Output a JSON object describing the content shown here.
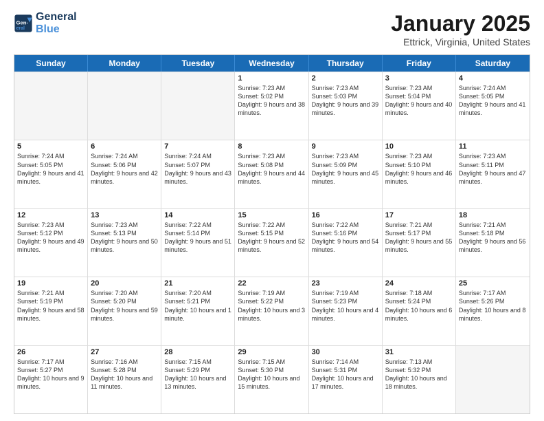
{
  "header": {
    "logo_line1": "General",
    "logo_line2": "Blue",
    "month": "January 2025",
    "location": "Ettrick, Virginia, United States"
  },
  "days_of_week": [
    "Sunday",
    "Monday",
    "Tuesday",
    "Wednesday",
    "Thursday",
    "Friday",
    "Saturday"
  ],
  "weeks": [
    [
      {
        "day": "",
        "text": ""
      },
      {
        "day": "",
        "text": ""
      },
      {
        "day": "",
        "text": ""
      },
      {
        "day": "1",
        "text": "Sunrise: 7:23 AM\nSunset: 5:02 PM\nDaylight: 9 hours and 38 minutes."
      },
      {
        "day": "2",
        "text": "Sunrise: 7:23 AM\nSunset: 5:03 PM\nDaylight: 9 hours and 39 minutes."
      },
      {
        "day": "3",
        "text": "Sunrise: 7:23 AM\nSunset: 5:04 PM\nDaylight: 9 hours and 40 minutes."
      },
      {
        "day": "4",
        "text": "Sunrise: 7:24 AM\nSunset: 5:05 PM\nDaylight: 9 hours and 41 minutes."
      }
    ],
    [
      {
        "day": "5",
        "text": "Sunrise: 7:24 AM\nSunset: 5:05 PM\nDaylight: 9 hours and 41 minutes."
      },
      {
        "day": "6",
        "text": "Sunrise: 7:24 AM\nSunset: 5:06 PM\nDaylight: 9 hours and 42 minutes."
      },
      {
        "day": "7",
        "text": "Sunrise: 7:24 AM\nSunset: 5:07 PM\nDaylight: 9 hours and 43 minutes."
      },
      {
        "day": "8",
        "text": "Sunrise: 7:23 AM\nSunset: 5:08 PM\nDaylight: 9 hours and 44 minutes."
      },
      {
        "day": "9",
        "text": "Sunrise: 7:23 AM\nSunset: 5:09 PM\nDaylight: 9 hours and 45 minutes."
      },
      {
        "day": "10",
        "text": "Sunrise: 7:23 AM\nSunset: 5:10 PM\nDaylight: 9 hours and 46 minutes."
      },
      {
        "day": "11",
        "text": "Sunrise: 7:23 AM\nSunset: 5:11 PM\nDaylight: 9 hours and 47 minutes."
      }
    ],
    [
      {
        "day": "12",
        "text": "Sunrise: 7:23 AM\nSunset: 5:12 PM\nDaylight: 9 hours and 49 minutes."
      },
      {
        "day": "13",
        "text": "Sunrise: 7:23 AM\nSunset: 5:13 PM\nDaylight: 9 hours and 50 minutes."
      },
      {
        "day": "14",
        "text": "Sunrise: 7:22 AM\nSunset: 5:14 PM\nDaylight: 9 hours and 51 minutes."
      },
      {
        "day": "15",
        "text": "Sunrise: 7:22 AM\nSunset: 5:15 PM\nDaylight: 9 hours and 52 minutes."
      },
      {
        "day": "16",
        "text": "Sunrise: 7:22 AM\nSunset: 5:16 PM\nDaylight: 9 hours and 54 minutes."
      },
      {
        "day": "17",
        "text": "Sunrise: 7:21 AM\nSunset: 5:17 PM\nDaylight: 9 hours and 55 minutes."
      },
      {
        "day": "18",
        "text": "Sunrise: 7:21 AM\nSunset: 5:18 PM\nDaylight: 9 hours and 56 minutes."
      }
    ],
    [
      {
        "day": "19",
        "text": "Sunrise: 7:21 AM\nSunset: 5:19 PM\nDaylight: 9 hours and 58 minutes."
      },
      {
        "day": "20",
        "text": "Sunrise: 7:20 AM\nSunset: 5:20 PM\nDaylight: 9 hours and 59 minutes."
      },
      {
        "day": "21",
        "text": "Sunrise: 7:20 AM\nSunset: 5:21 PM\nDaylight: 10 hours and 1 minute."
      },
      {
        "day": "22",
        "text": "Sunrise: 7:19 AM\nSunset: 5:22 PM\nDaylight: 10 hours and 3 minutes."
      },
      {
        "day": "23",
        "text": "Sunrise: 7:19 AM\nSunset: 5:23 PM\nDaylight: 10 hours and 4 minutes."
      },
      {
        "day": "24",
        "text": "Sunrise: 7:18 AM\nSunset: 5:24 PM\nDaylight: 10 hours and 6 minutes."
      },
      {
        "day": "25",
        "text": "Sunrise: 7:17 AM\nSunset: 5:26 PM\nDaylight: 10 hours and 8 minutes."
      }
    ],
    [
      {
        "day": "26",
        "text": "Sunrise: 7:17 AM\nSunset: 5:27 PM\nDaylight: 10 hours and 9 minutes."
      },
      {
        "day": "27",
        "text": "Sunrise: 7:16 AM\nSunset: 5:28 PM\nDaylight: 10 hours and 11 minutes."
      },
      {
        "day": "28",
        "text": "Sunrise: 7:15 AM\nSunset: 5:29 PM\nDaylight: 10 hours and 13 minutes."
      },
      {
        "day": "29",
        "text": "Sunrise: 7:15 AM\nSunset: 5:30 PM\nDaylight: 10 hours and 15 minutes."
      },
      {
        "day": "30",
        "text": "Sunrise: 7:14 AM\nSunset: 5:31 PM\nDaylight: 10 hours and 17 minutes."
      },
      {
        "day": "31",
        "text": "Sunrise: 7:13 AM\nSunset: 5:32 PM\nDaylight: 10 hours and 18 minutes."
      },
      {
        "day": "",
        "text": ""
      }
    ]
  ]
}
